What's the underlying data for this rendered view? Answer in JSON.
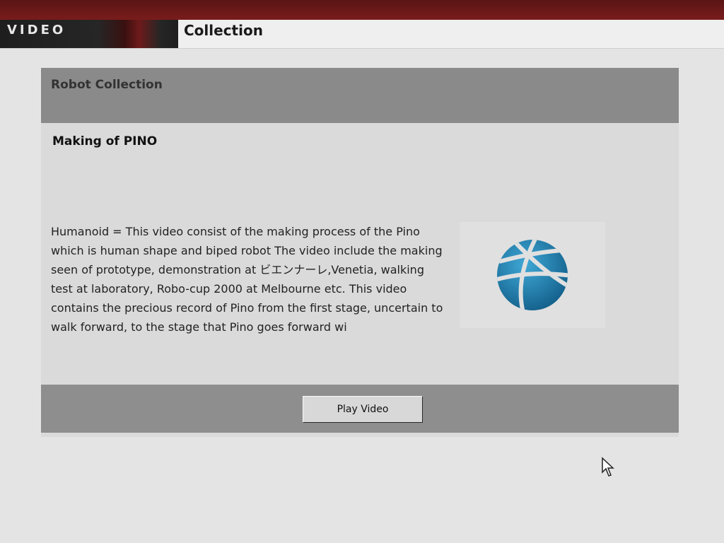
{
  "nav": {
    "section_label": "VIDEO",
    "page_title": "Collection"
  },
  "panel": {
    "header_title": "Robot Collection",
    "item_title": "Making of PINO",
    "description": "Humanoid = This video consist of the making process of the Pino which is human shape and biped robot The video include the making seen of prototype, demonstration at ビエンナーレ,Venetia, walking test at laboratory, Robo-cup 2000 at Melbourne etc. This video contains the precious record of Pino from the first stage, uncertain to walk forward, to the stage that Pino goes forward wi",
    "thumbnail_icon": "globe-icon",
    "play_button_label": "Play Video"
  },
  "colors": {
    "top_bar": "#6a1818",
    "panel_header": "#8a8a8a",
    "globe_blue": "#1f7fae"
  }
}
